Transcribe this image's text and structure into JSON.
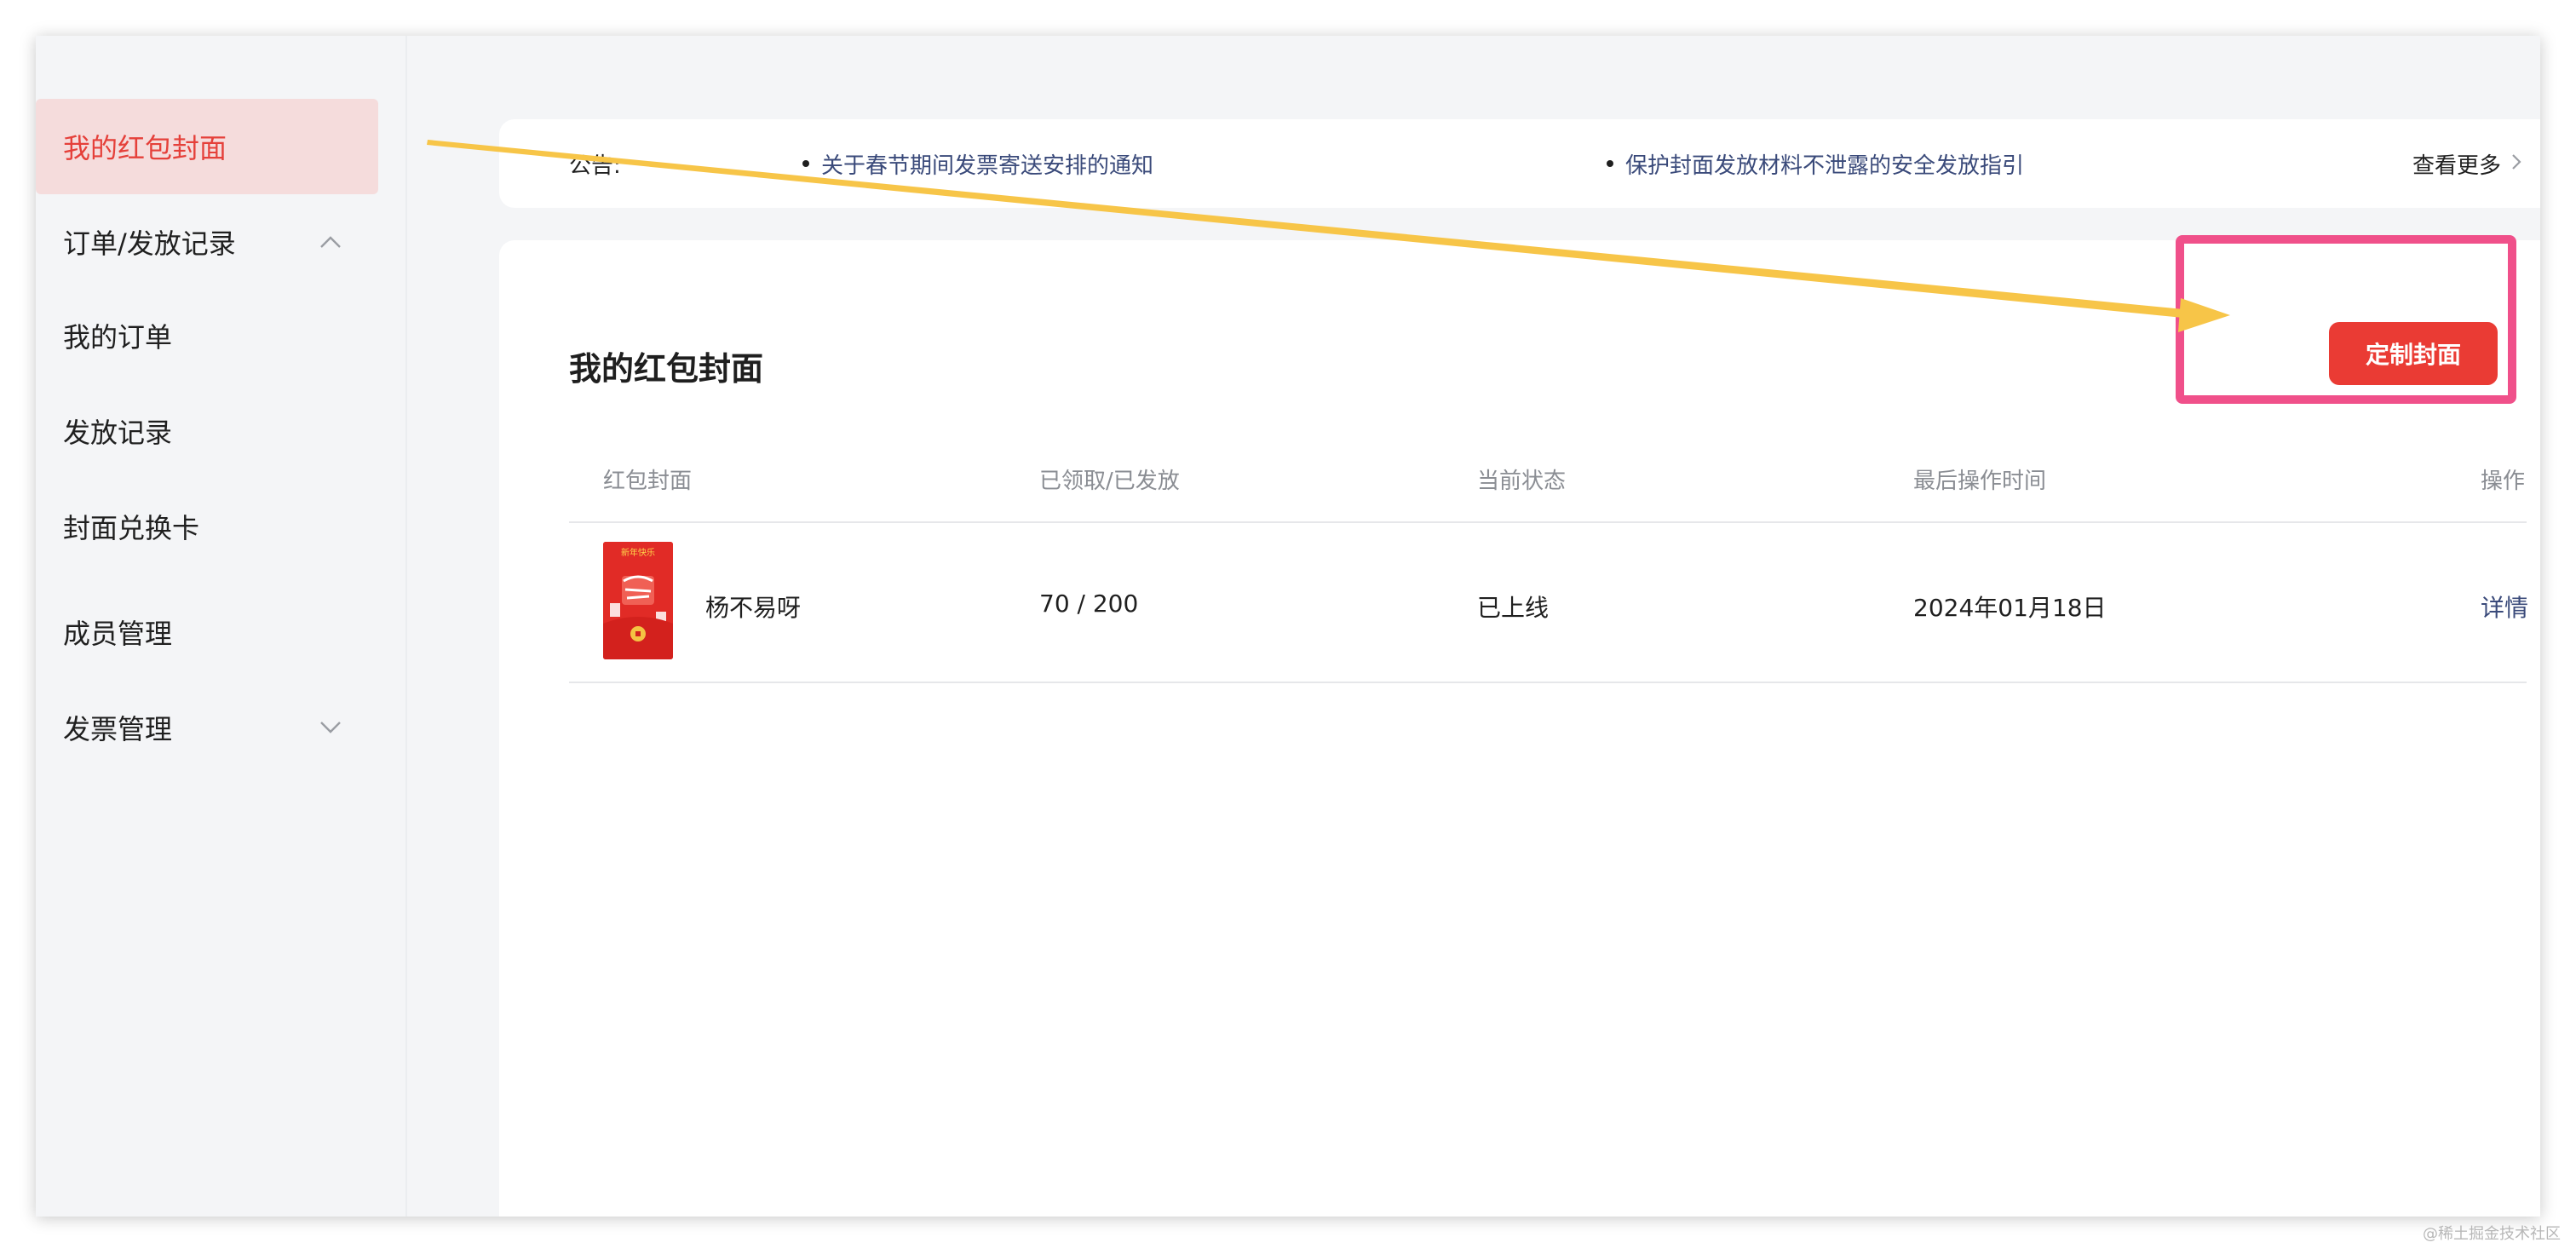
{
  "sidebar": {
    "items": [
      {
        "label": "我的红包封面",
        "active": true
      },
      {
        "label": "订单/发放记录",
        "chevron": "chevron-up-icon"
      },
      {
        "label": "我的订单"
      },
      {
        "label": "发放记录"
      },
      {
        "label": "封面兑换卡"
      },
      {
        "label": "成员管理"
      },
      {
        "label": "发票管理",
        "chevron": "chevron-down-icon"
      }
    ]
  },
  "notice": {
    "label": "公告:",
    "links": [
      "关于春节期间发票寄送安排的通知",
      "保护封面发放材料不泄露的安全发放指引"
    ],
    "more": "查看更多"
  },
  "main": {
    "title": "我的红包封面",
    "cta": "定制封面",
    "columns": [
      "红包封面",
      "已领取/已发放",
      "当前状态",
      "最后操作时间",
      "操作"
    ],
    "rows": [
      {
        "cover_name": "杨不易呀",
        "claimed": "70 / 200",
        "status": "已上线",
        "last_time": "2024年01月18日",
        "action": "详情",
        "thumb_caption": "新年快乐"
      }
    ]
  },
  "watermark": "@稀土掘金技术社区",
  "colors": {
    "accent": "#ea3b34",
    "link": "#3a4a7a",
    "active_bg": "#f5dcdc",
    "highlight": "#f0508a",
    "arrow": "#f7c548"
  }
}
